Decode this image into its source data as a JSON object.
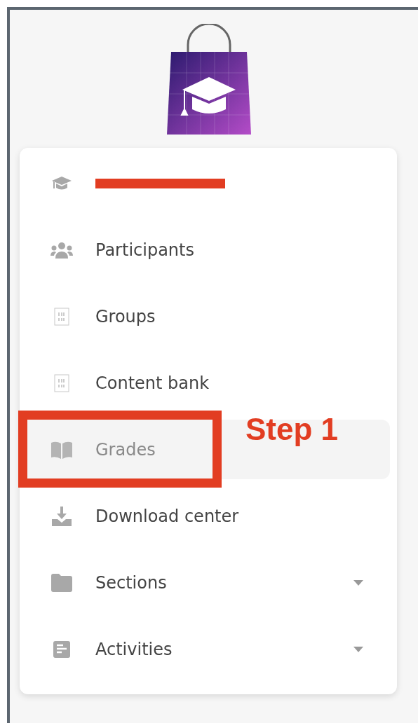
{
  "nav": {
    "items": [
      {
        "kind": "redacted",
        "selected": false,
        "expandable": false
      },
      {
        "kind": "link",
        "label": "Participants",
        "selected": false,
        "expandable": false
      },
      {
        "kind": "link",
        "label": "Groups",
        "selected": false,
        "expandable": false
      },
      {
        "kind": "link",
        "label": "Content bank",
        "selected": false,
        "expandable": false
      },
      {
        "kind": "link",
        "label": "Grades",
        "selected": true,
        "expandable": false
      },
      {
        "kind": "link",
        "label": "Download center",
        "selected": false,
        "expandable": false
      },
      {
        "kind": "link",
        "label": "Sections",
        "selected": false,
        "expandable": true
      },
      {
        "kind": "link",
        "label": "Activities",
        "selected": false,
        "expandable": true
      }
    ]
  },
  "annotation": {
    "label": "Step 1"
  }
}
